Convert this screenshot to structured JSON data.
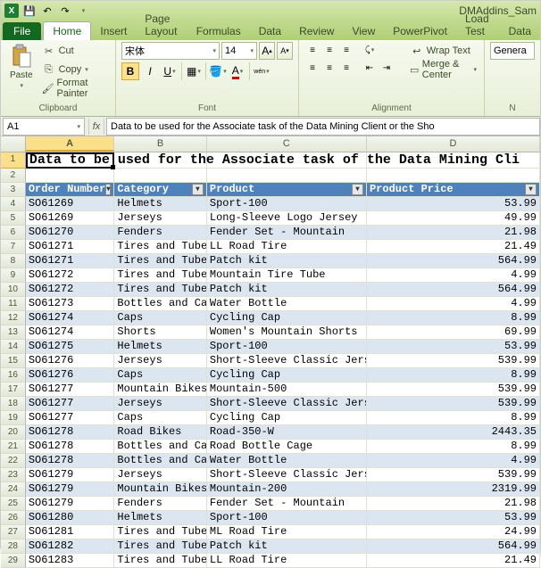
{
  "titlebar": {
    "doc_name": "DMAddins_Sam"
  },
  "tabs": {
    "file": "File",
    "items": [
      "Home",
      "Insert",
      "Page Layout",
      "Formulas",
      "Data",
      "Review",
      "View",
      "PowerPivot",
      "Load Test",
      "Data"
    ]
  },
  "ribbon": {
    "clipboard": {
      "paste": "Paste",
      "cut": "Cut",
      "copy": "Copy",
      "format_painter": "Format Painter",
      "label": "Clipboard"
    },
    "font": {
      "name": "宋体",
      "size": "14",
      "grow": "A",
      "shrink": "A",
      "label": "Font"
    },
    "alignment": {
      "wrap": "Wrap Text",
      "merge": "Merge & Center",
      "label": "Alignment"
    },
    "number": {
      "style": "Genera",
      "label": "N"
    }
  },
  "formula_bar": {
    "name_box": "A1",
    "fx": "fx",
    "formula": "Data to be used for the Associate task of the Data Mining Client or the Sho"
  },
  "grid": {
    "columns": [
      "A",
      "B",
      "C",
      "D"
    ],
    "title_row": "Data to be used for the Associate task of the Data Mining Cli",
    "headers": [
      "Order Number",
      "Category",
      "Product",
      "Product Price"
    ],
    "rows": [
      {
        "n": 4,
        "a": "SO61269",
        "b": "Helmets",
        "c": "Sport-100",
        "d": "53.99"
      },
      {
        "n": 5,
        "a": "SO61269",
        "b": "Jerseys",
        "c": "Long-Sleeve Logo Jersey",
        "d": "49.99"
      },
      {
        "n": 6,
        "a": "SO61270",
        "b": "Fenders",
        "c": "Fender Set - Mountain",
        "d": "21.98"
      },
      {
        "n": 7,
        "a": "SO61271",
        "b": "Tires and Tubes",
        "c": "LL Road Tire",
        "d": "21.49"
      },
      {
        "n": 8,
        "a": "SO61271",
        "b": "Tires and Tubes",
        "c": "Patch kit",
        "d": "564.99"
      },
      {
        "n": 9,
        "a": "SO61272",
        "b": "Tires and Tubes",
        "c": "Mountain Tire Tube",
        "d": "4.99"
      },
      {
        "n": 10,
        "a": "SO61272",
        "b": "Tires and Tubes",
        "c": "Patch kit",
        "d": "564.99"
      },
      {
        "n": 11,
        "a": "SO61273",
        "b": "Bottles and Cages",
        "c": "Water Bottle",
        "d": "4.99"
      },
      {
        "n": 12,
        "a": "SO61274",
        "b": "Caps",
        "c": "Cycling Cap",
        "d": "8.99"
      },
      {
        "n": 13,
        "a": "SO61274",
        "b": "Shorts",
        "c": "Women's Mountain Shorts",
        "d": "69.99"
      },
      {
        "n": 14,
        "a": "SO61275",
        "b": "Helmets",
        "c": "Sport-100",
        "d": "53.99"
      },
      {
        "n": 15,
        "a": "SO61276",
        "b": "Jerseys",
        "c": "Short-Sleeve Classic Jers",
        "d": "539.99"
      },
      {
        "n": 16,
        "a": "SO61276",
        "b": "Caps",
        "c": "Cycling Cap",
        "d": "8.99"
      },
      {
        "n": 17,
        "a": "SO61277",
        "b": "Mountain Bikes",
        "c": "Mountain-500",
        "d": "539.99"
      },
      {
        "n": 18,
        "a": "SO61277",
        "b": "Jerseys",
        "c": "Short-Sleeve Classic Jers",
        "d": "539.99"
      },
      {
        "n": 19,
        "a": "SO61277",
        "b": "Caps",
        "c": "Cycling Cap",
        "d": "8.99"
      },
      {
        "n": 20,
        "a": "SO61278",
        "b": "Road Bikes",
        "c": "Road-350-W",
        "d": "2443.35"
      },
      {
        "n": 21,
        "a": "SO61278",
        "b": "Bottles and Cages",
        "c": "Road Bottle Cage",
        "d": "8.99"
      },
      {
        "n": 22,
        "a": "SO61278",
        "b": "Bottles and Cages",
        "c": "Water Bottle",
        "d": "4.99"
      },
      {
        "n": 23,
        "a": "SO61279",
        "b": "Jerseys",
        "c": "Short-Sleeve Classic Jers",
        "d": "539.99"
      },
      {
        "n": 24,
        "a": "SO61279",
        "b": "Mountain Bikes",
        "c": "Mountain-200",
        "d": "2319.99"
      },
      {
        "n": 25,
        "a": "SO61279",
        "b": "Fenders",
        "c": "Fender Set - Mountain",
        "d": "21.98"
      },
      {
        "n": 26,
        "a": "SO61280",
        "b": "Helmets",
        "c": "Sport-100",
        "d": "53.99"
      },
      {
        "n": 27,
        "a": "SO61281",
        "b": "Tires and Tubes",
        "c": "ML Road Tire",
        "d": "24.99"
      },
      {
        "n": 28,
        "a": "SO61282",
        "b": "Tires and Tubes",
        "c": "Patch kit",
        "d": "564.99"
      },
      {
        "n": 29,
        "a": "SO61283",
        "b": "Tires and Tubes",
        "c": "LL Road Tire",
        "d": "21.49"
      }
    ]
  }
}
